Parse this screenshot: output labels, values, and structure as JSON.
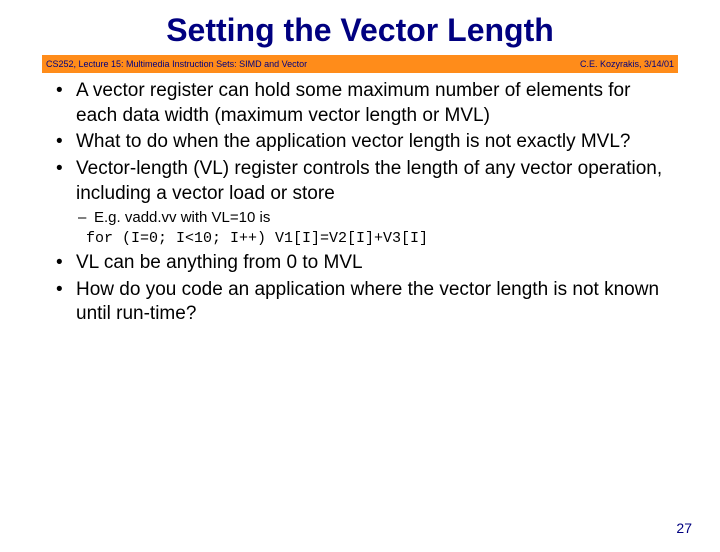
{
  "title": "Setting the Vector Length",
  "banner": {
    "left": "CS252, Lecture 15: Multimedia Instruction Sets: SIMD and Vector",
    "right": "C.E. Kozyrakis, 3/14/01"
  },
  "bullets": {
    "b1": "A vector register can hold some maximum number of elements for each data width (maximum vector length or MVL)",
    "b2": "What to do when the application vector length is not exactly MVL?",
    "b3": "Vector-length (VL) register controls the length of any vector operation, including a vector load or store",
    "b4": "VL can be anything from 0 to MVL",
    "b5": "How do you code an application where the vector length is not known until run-time?"
  },
  "sub": {
    "s1": "E.g. vadd.vv with VL=10 is",
    "code": "for (I=0; I<10; I++) V1[I]=V2[I]+V3[I]"
  },
  "page_number": "27"
}
